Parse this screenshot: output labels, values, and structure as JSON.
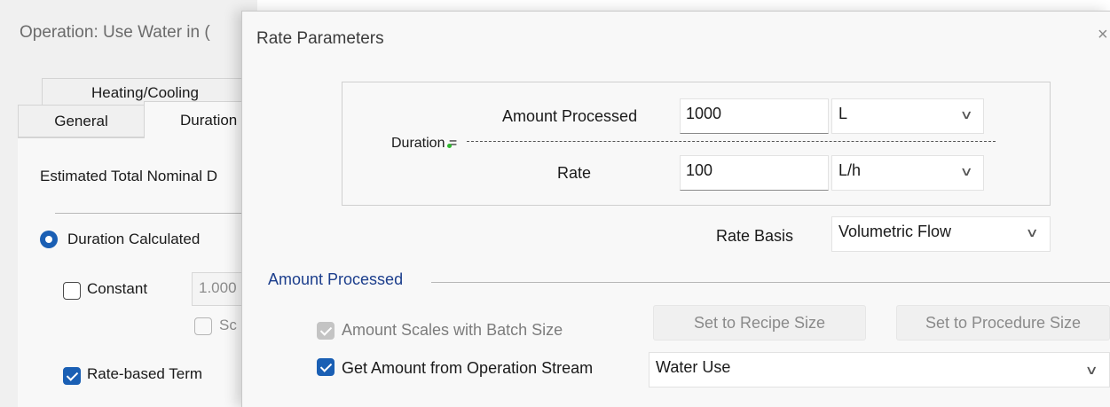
{
  "background_dialog": {
    "title": "Operation: Use Water in (",
    "tabs": [
      {
        "label": "Heating/Cooling"
      },
      {
        "label": "General"
      },
      {
        "label": "Duration"
      }
    ],
    "estimated_label": "Estimated Total Nominal D",
    "duration_calculated": {
      "label": "Duration Calculated",
      "selected": true
    },
    "constant": {
      "label": "Constant",
      "checked": false,
      "value": "1.000"
    },
    "scales": {
      "label": "Sc",
      "checked": false,
      "enabled": false
    },
    "rate_based": {
      "label": "Rate-based Term",
      "checked": true
    }
  },
  "rate_dialog": {
    "title": "Rate Parameters",
    "close_glyph": "×",
    "duration_label": "Duration =",
    "amount_processed": {
      "label": "Amount Processed",
      "value": "1000",
      "unit": "L"
    },
    "rate": {
      "label": "Rate",
      "value": "100",
      "unit": "L/h"
    },
    "rate_basis": {
      "label": "Rate Basis",
      "value": "Volumetric Flow"
    },
    "amount_section": {
      "title": "Amount Processed",
      "scales_with_batch": {
        "label": "Amount Scales with Batch Size",
        "checked": true,
        "enabled": false
      },
      "set_recipe_label": "Set to Recipe Size",
      "set_procedure_label": "Set to Procedure Size",
      "get_from_stream": {
        "label": "Get Amount from Operation Stream",
        "checked": true
      },
      "stream": "Water Use"
    }
  },
  "colors": {
    "accent": "#1a5fb4",
    "section_heading": "#1c3e8c",
    "dialog_background": "#f8f8f8",
    "disabled_text": "#8a8a8a"
  },
  "icons": {
    "chevron": "chevron-down-icon",
    "close": "close-icon",
    "check": "check-icon"
  }
}
